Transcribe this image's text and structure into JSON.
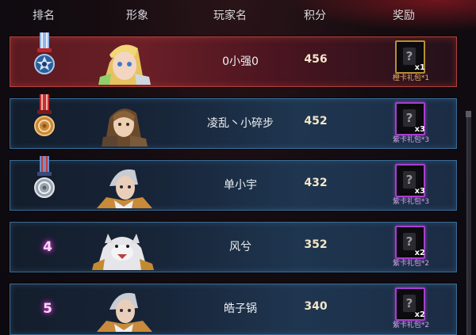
{
  "header": {
    "rank": "排名",
    "avatar": "形象",
    "player": "玩家名",
    "score": "积分",
    "reward": "奖励"
  },
  "rows": [
    {
      "rank": "",
      "medal": "gold-blue-star-medal",
      "name": "0小强0",
      "score": "456",
      "reward_mult": "x1",
      "reward_label": "橙卡礼包*1",
      "card_color": "#b89030"
    },
    {
      "rank": "",
      "medal": "bronze-medal",
      "name": "凌乱丶小碎步",
      "score": "452",
      "reward_mult": "x3",
      "reward_label": "紫卡礼包*3",
      "card_color": "#a83ed0"
    },
    {
      "rank": "",
      "medal": "silver-medal",
      "name": "单小宇",
      "score": "432",
      "reward_mult": "x3",
      "reward_label": "紫卡礼包*3",
      "card_color": "#a83ed0"
    },
    {
      "rank": "4",
      "medal": "",
      "name": "风兮",
      "score": "352",
      "reward_mult": "x2",
      "reward_label": "紫卡礼包*2",
      "card_color": "#a83ed0"
    },
    {
      "rank": "5",
      "medal": "",
      "name": "皓子锅",
      "score": "340",
      "reward_mult": "x2",
      "reward_label": "紫卡礼包*2",
      "card_color": "#a83ed0"
    }
  ],
  "colors": {
    "first_row_border": "#b3413f",
    "row_border": "#3a6c94",
    "rank_glow": "#e13fd6",
    "orange_label": "#e9b36b",
    "purple_label": "#d4a7e8"
  }
}
